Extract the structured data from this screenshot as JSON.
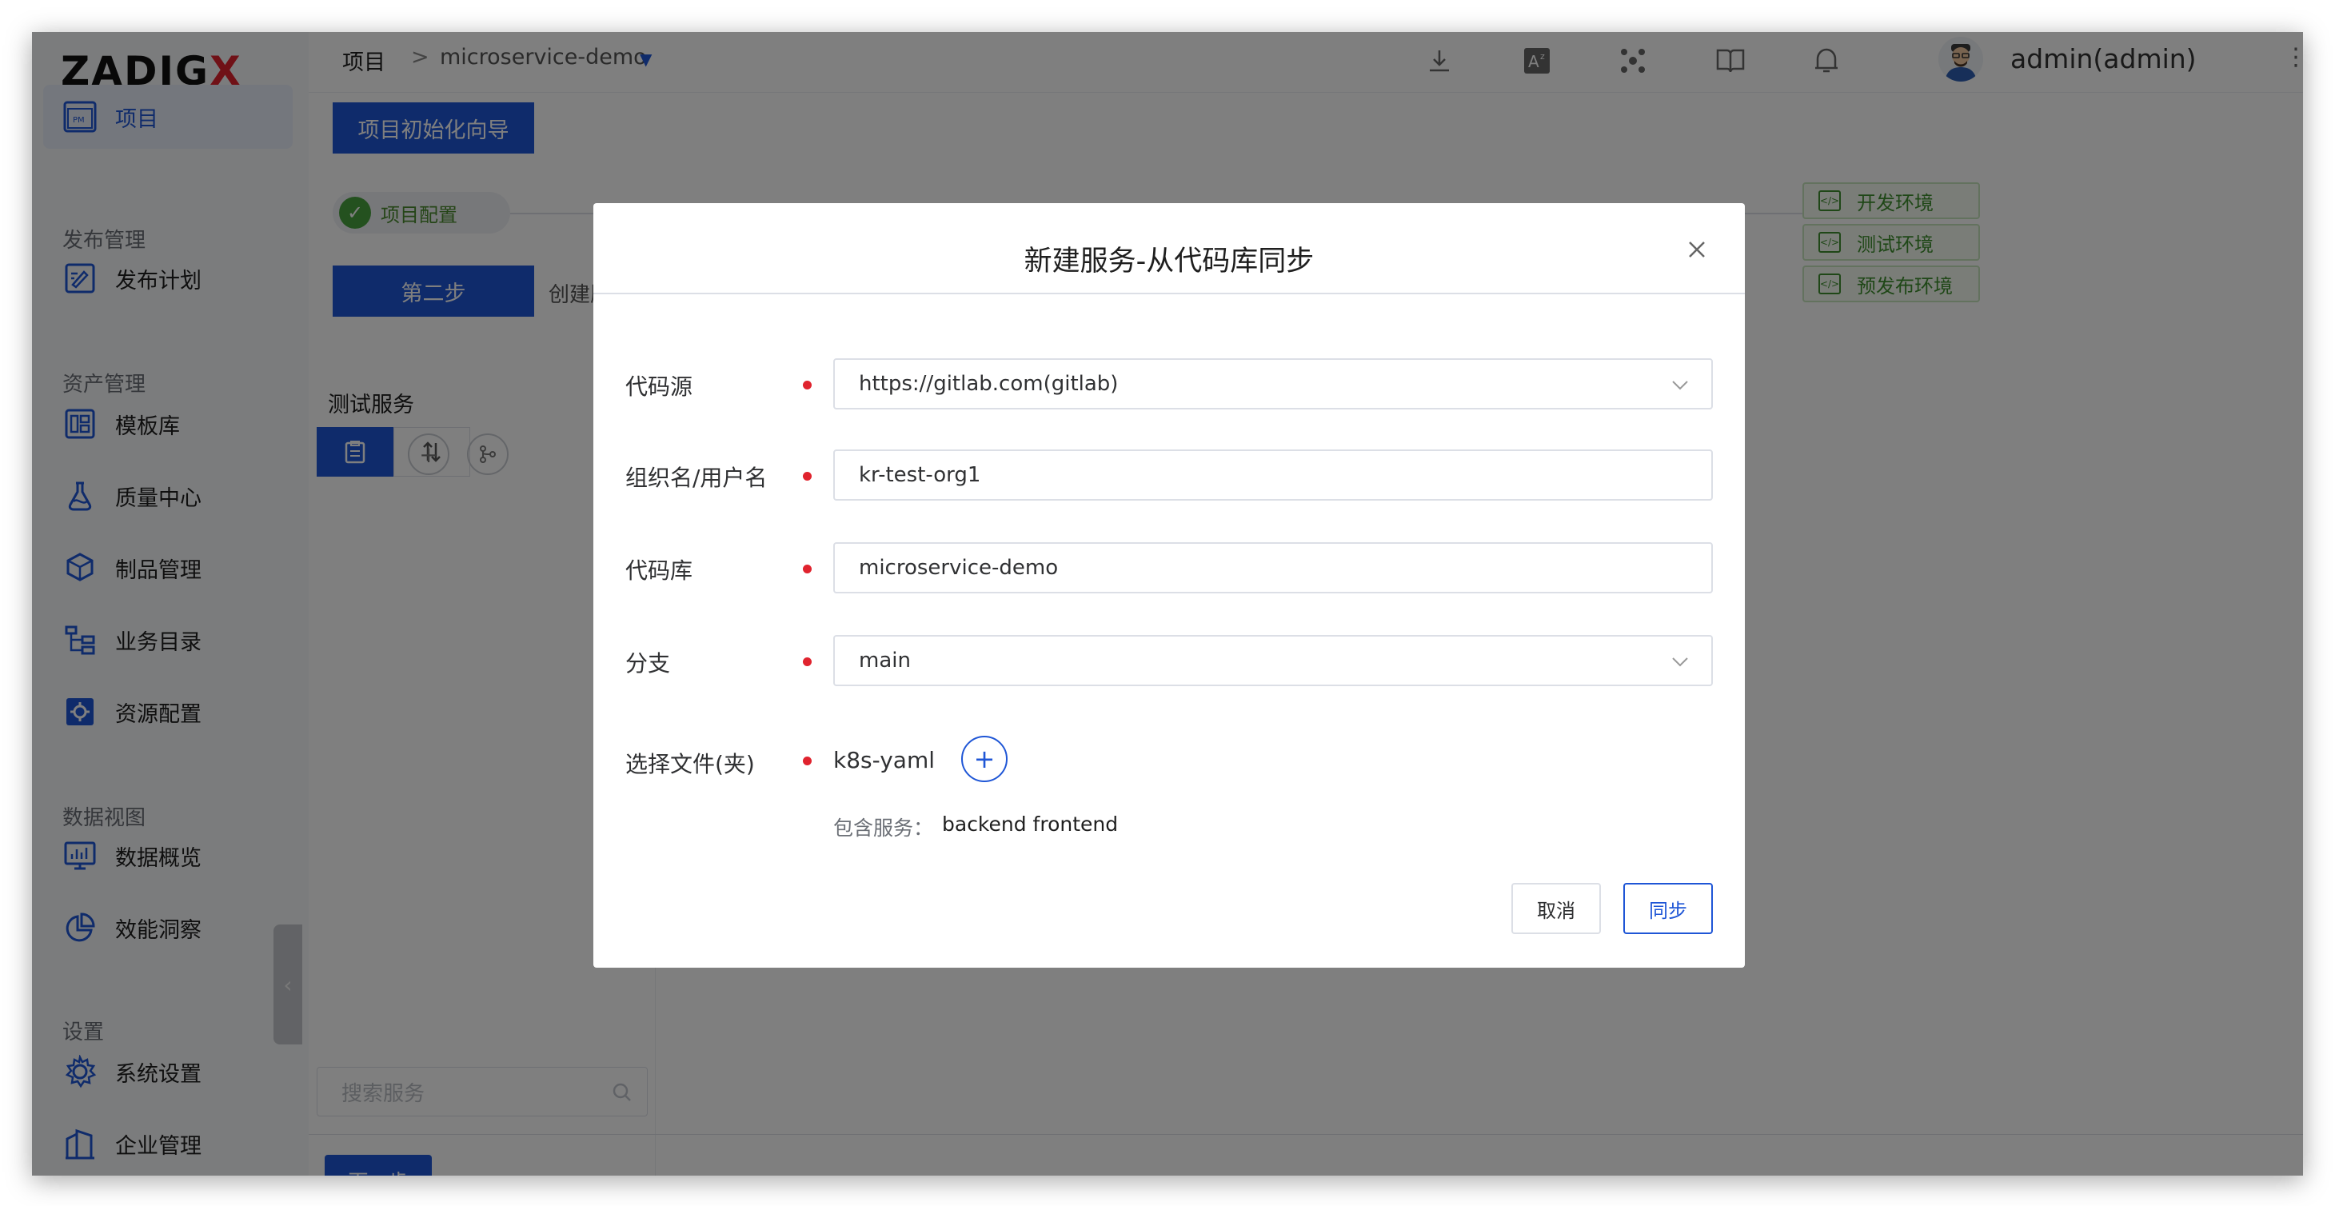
{
  "app": {
    "logo_main": "ZADIG",
    "logo_accent": "X"
  },
  "sidebar": {
    "items": [
      {
        "label": "项目",
        "icon": "project-icon",
        "active": true
      },
      {
        "label": "发布计划",
        "icon": "release-plan-icon"
      },
      {
        "label": "模板库",
        "icon": "template-icon"
      },
      {
        "label": "质量中心",
        "icon": "flask-icon"
      },
      {
        "label": "制品管理",
        "icon": "artifact-icon"
      },
      {
        "label": "业务目录",
        "icon": "catalog-icon"
      },
      {
        "label": "资源配置",
        "icon": "resource-icon"
      },
      {
        "label": "数据概览",
        "icon": "monitor-icon"
      },
      {
        "label": "效能洞察",
        "icon": "pie-chart-icon"
      },
      {
        "label": "系统设置",
        "icon": "gear-icon"
      },
      {
        "label": "企业管理",
        "icon": "enterprise-icon"
      }
    ],
    "sections": [
      "发布管理",
      "资产管理",
      "数据视图",
      "设置"
    ]
  },
  "header": {
    "breadcrumb_root": "项目",
    "breadcrumb_sep": ">",
    "project_name": "microservice-demo",
    "username": "admin(admin)"
  },
  "page": {
    "wizard_button": "项目初始化向导",
    "step1_label": "项目配置",
    "step2_button": "第二步",
    "step2_label": "创建服",
    "env_tags": [
      "开发环境",
      "测试环境",
      "预发布环境"
    ],
    "service_panel_title": "测试服务",
    "search_placeholder": "搜索服务",
    "next_button": "下一步"
  },
  "dialog": {
    "title": "新建服务-从代码库同步",
    "fields": {
      "source_label": "代码源",
      "source_value": "https://gitlab.com(gitlab)",
      "org_label": "组织名/用户名",
      "org_value": "kr-test-org1",
      "repo_label": "代码库",
      "repo_value": "microservice-demo",
      "branch_label": "分支",
      "branch_value": "main",
      "file_label": "选择文件(夹)",
      "file_value": "k8s-yaml"
    },
    "contains_label": "包含服务：",
    "contains_value": "backend frontend",
    "cancel_button": "取消",
    "sync_button": "同步"
  },
  "colors": {
    "primary": "#1f56d6",
    "required": "#e0232e",
    "success": "#48a23f"
  }
}
